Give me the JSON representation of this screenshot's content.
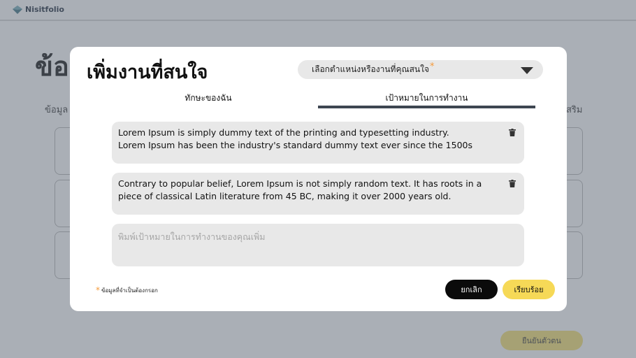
{
  "app": {
    "name": "Nisitfolio"
  },
  "background": {
    "title": "ข้อ",
    "subtitle_left": "ข้อมูล",
    "subtitle_right": "สริม",
    "confirm_button": "ยืนยันตัวตน"
  },
  "modal": {
    "title": "เพิ่มงานที่สนใจ",
    "select": {
      "placeholder": "เลือกตำแหน่งหรืองานที่คุณสนใจ",
      "required_mark": "*"
    },
    "tabs": [
      {
        "label": "ทักษะของฉัน",
        "active": false
      },
      {
        "label": "เป้าหมายในการทำงาน",
        "active": true
      }
    ],
    "goals": [
      {
        "text": "Lorem Ipsum is simply dummy text of the printing and typesetting industry.\nLorem Ipsum has been the industry's standard dummy text ever since the 1500s"
      },
      {
        "text": "Contrary to popular belief, Lorem Ipsum is not simply random text. It has roots in a piece of classical Latin literature from 45 BC, making it over 2000 years old."
      }
    ],
    "goal_input": {
      "placeholder": "พิมพ์เป้าหมายในการทำงานของคุณเพิ่ม",
      "value": ""
    },
    "required_note": {
      "mark": "*",
      "text": "ข้อมูลที่จำเป็นต้องกรอก"
    },
    "buttons": {
      "cancel": "ยกเลิก",
      "done": "เรียบร้อย"
    }
  },
  "colors": {
    "accent_yellow": "#f6d957",
    "required_orange": "#f59a3a",
    "tab_underline": "#3e4651",
    "field_bg": "#e8e8e8",
    "overlay": "#555f6e"
  },
  "icons": {
    "logo": "diamond-logo-icon",
    "dropdown": "triangle-down-icon",
    "delete": "trash-icon"
  }
}
